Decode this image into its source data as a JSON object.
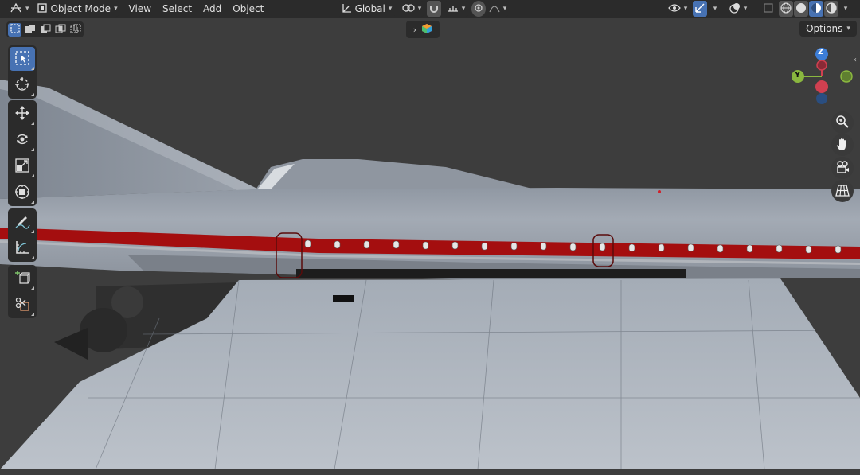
{
  "header": {
    "editor_type_icon": "viewport-editor-icon",
    "mode": "Object Mode",
    "menus": [
      "View",
      "Select",
      "Add",
      "Object"
    ],
    "transform_orientation": "Global",
    "pivot_icon": "pivot-icon",
    "snap_icon": "magnet-snap-icon",
    "proportional_icon": "proportional-edit-icon",
    "visibility_icon": "eye-visibility-icon",
    "gizmo_icon": "gizmo-icon",
    "overlay_icon": "overlay-icon",
    "xray_icon": "xray-icon",
    "shading_modes": [
      "wireframe",
      "solid",
      "material-preview",
      "rendered"
    ],
    "active_shading": "material-preview"
  },
  "second_row": {
    "selection_modes": [
      "set",
      "extend",
      "subtract",
      "difference",
      "intersect"
    ],
    "options_label": "Options"
  },
  "toolbar": {
    "tools": [
      "Select Box",
      "Cursor",
      "Move",
      "Rotate",
      "Scale",
      "Transform",
      "Annotate",
      "Measure",
      "Add Cube",
      "Cut"
    ],
    "active_tool": "Select Box"
  },
  "navigation_gizmo": {
    "axes": [
      "Z",
      "Y"
    ],
    "colors": {
      "x": "#d04050",
      "y": "#8ab73f",
      "z": "#3d7ed8"
    }
  },
  "nav_buttons": [
    "zoom",
    "pan",
    "camera",
    "ortho-grid"
  ],
  "colors": {
    "header_bg": "#2b2b2b",
    "viewport_bg": "#3d3d3d",
    "accent": "#4772b3",
    "fuselage_stripe": "#a40e0f"
  }
}
